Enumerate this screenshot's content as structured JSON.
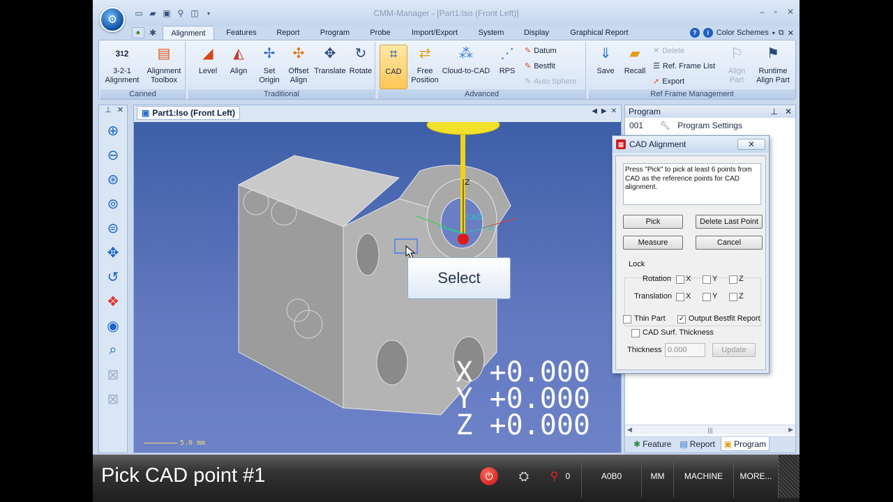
{
  "window": {
    "title": "CMM-Manager - [Part1:Iso (Front Left)]",
    "controls": [
      "–",
      "▫",
      "✕"
    ]
  },
  "tabs": [
    "Alignment",
    "Features",
    "Report",
    "Program",
    "Probe",
    "Import/Export",
    "System",
    "Display",
    "Graphical Report"
  ],
  "tab_right": {
    "color_schemes": "Color Schemes"
  },
  "ribbon": {
    "canned": {
      "title": "Canned",
      "b1": "3-2-1\nAlignment",
      "b2": "Alignment\nToolbox"
    },
    "traditional": {
      "title": "Traditional",
      "level": "Level",
      "align": "Align",
      "set_origin": "Set\nOrigin",
      "offset_align": "Offset\nAlign",
      "translate": "Translate",
      "rotate": "Rotate"
    },
    "advanced": {
      "title": "Advanced",
      "cad": "CAD",
      "free_position": "Free\nPosition",
      "cloud_to_cad": "Cloud-to-CAD",
      "rps": "RPS",
      "datum": "Datum",
      "bestfit": "Bestfit",
      "auto_sphere": "Auto Sphere"
    },
    "ref_frame": {
      "title": "Ref Frame Management",
      "save": "Save",
      "recall": "Recall",
      "delete": "Delete",
      "ref_frame_list": "Ref. Frame List",
      "export": "Export",
      "align_part": "Align\nPart",
      "runtime_align_part": "Runtime\nAlign Part"
    }
  },
  "viewport": {
    "tab_title": "Part1:Iso (Front Left)",
    "tooltip": "Select",
    "readout": {
      "x_label": "X",
      "x": "+0.000",
      "y_label": "Y",
      "y": "+0.000",
      "z_label": "Z",
      "z": "+0.000"
    },
    "scale": "5.0 mm",
    "axis_labels": {
      "z": "Z",
      "x": "X",
      "cad": "CAD"
    }
  },
  "program_panel": {
    "title": "Program",
    "rows": [
      {
        "id": "001",
        "label": "Program Settings"
      }
    ],
    "tabs": [
      "Feature",
      "Report",
      "Program"
    ]
  },
  "dialog": {
    "title": "CAD Alignment",
    "close": "✕",
    "instruction": "Press \"Pick\" to pick at least 6 points from CAD as the reference points for CAD alignment.",
    "pick": "Pick",
    "delete_last_point": "Delete Last Point",
    "measure": "Measure",
    "cancel": "Cancel",
    "lock_title": "Lock",
    "rotation": "Rotation",
    "translation": "Translation",
    "axes": [
      "X",
      "Y",
      "Z"
    ],
    "thin_part": "Thin Part",
    "output_bestfit_report": "Output Bestfit Report",
    "output_bestfit_checked": true,
    "cad_surf_thickness": "CAD Surf. Thickness",
    "thickness_label": "Thickness",
    "thickness_value": "0.000",
    "update": "Update"
  },
  "status": {
    "message": "Pick CAD point #1",
    "probe_count": "0",
    "tip": "A0B0",
    "units": "MM",
    "mode": "MACHINE",
    "more": "MORE..."
  }
}
